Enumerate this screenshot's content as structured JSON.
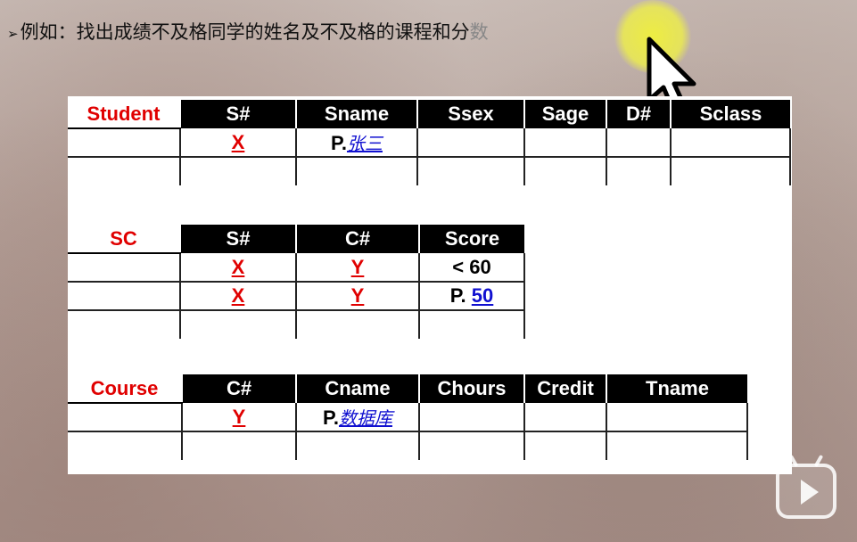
{
  "heading": {
    "bullet": "➢",
    "text": "例如：找出成绩不及格同学的姓名及不及格的课程和分",
    "tail": "数"
  },
  "student_table": {
    "relation": "Student",
    "columns": [
      "S#",
      "Sname",
      "Ssex",
      "Sage",
      "D#",
      "Sclass"
    ],
    "rows": [
      [
        "",
        "X",
        "P.",
        "张三",
        "",
        "",
        "",
        ""
      ],
      [
        "",
        "",
        "",
        "",
        "",
        "",
        "",
        ""
      ]
    ],
    "row1": {
      "s": "X",
      "sname_prefix": "P.",
      "sname_value": "张三"
    }
  },
  "sc_table": {
    "relation": "SC",
    "columns": [
      "S#",
      "C#",
      "Score"
    ],
    "row1": {
      "s": "X",
      "c": "Y",
      "score": "< 60"
    },
    "row2": {
      "s": "X",
      "c": "Y",
      "score_prefix": "P.",
      "score_value": "50"
    }
  },
  "course_table": {
    "relation": "Course",
    "columns": [
      "C#",
      "Cname",
      "Chours",
      "Credit",
      "Tname"
    ],
    "row1": {
      "c": "Y",
      "cname_prefix": "P.",
      "cname_value": "数据库"
    }
  },
  "colors": {
    "relation_name": "#e00000",
    "variable": "#e00000",
    "example_value": "#1010d0",
    "header_bg": "#000000",
    "highlight": "#f0f03c"
  }
}
